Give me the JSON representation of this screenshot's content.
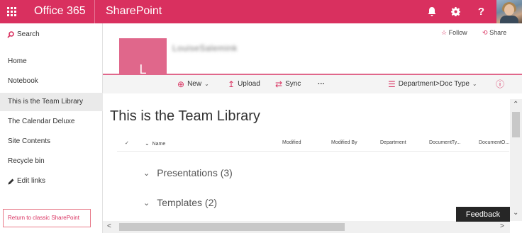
{
  "suitebar": {
    "app_name": "Office 365",
    "site_app": "SharePoint",
    "help_label": "?"
  },
  "leftnav": {
    "search_label": "Search",
    "items": [
      {
        "label": "Home"
      },
      {
        "label": "Notebook"
      },
      {
        "label": "This is the Team Library",
        "selected": true
      },
      {
        "label": "The Calendar Deluxe"
      },
      {
        "label": "Site Contents"
      },
      {
        "label": "Recycle bin"
      }
    ],
    "edit_links": "Edit links",
    "return_classic": "Return to classic SharePoint"
  },
  "header": {
    "follow_label": "Follow",
    "share_label": "Share",
    "site_logo_letter": "L",
    "site_name": "LouiseSalemink"
  },
  "commandbar": {
    "new_label": "New",
    "upload_label": "Upload",
    "sync_label": "Sync",
    "more_label": "···",
    "view_label": "Department>Doc Type"
  },
  "library": {
    "title": "This is the Team Library",
    "columns": {
      "check": "✓",
      "name": "Name",
      "modified": "Modified",
      "modified_by": "Modified By",
      "department": "Department",
      "document_type": "DocumentTy...",
      "document_other": "DocumentO..."
    },
    "groups": [
      {
        "label": "Presentations (3)"
      },
      {
        "label": "Templates (2)"
      }
    ]
  },
  "feedback_label": "Feedback",
  "colors": {
    "accent": "#d9305f",
    "site_logo": "#e0678b",
    "selected_nav": "#eaeaea"
  }
}
